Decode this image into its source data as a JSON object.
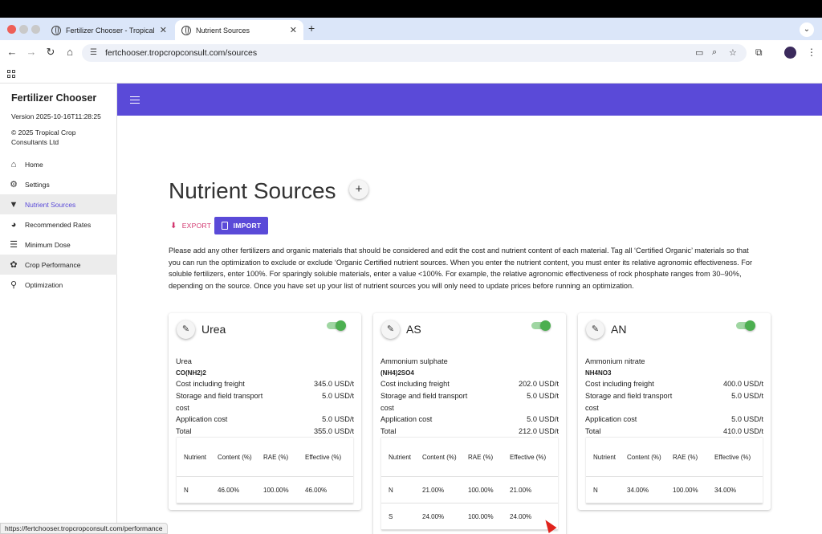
{
  "browser": {
    "tabs": [
      {
        "title": "Fertilizer Chooser - Tropical C",
        "close": "✕"
      },
      {
        "title": "Nutrient Sources",
        "close": "✕"
      }
    ],
    "new_tab": "+",
    "url": "fertchooser.tropcropconsult.com/sources",
    "status_url": "https://fertchooser.tropcropconsult.com/performance",
    "icons": [
      "back-icon",
      "forward-icon",
      "reload-icon",
      "home-icon",
      "tune-icon",
      "install-icon",
      "zoom-icon",
      "star-icon",
      "extensions-icon",
      "profile-icon",
      "menu-icon",
      "apps-icon"
    ]
  },
  "sidebar": {
    "app_title": "Fertilizer Chooser",
    "version": "Version 2025-10-16T11:28:25",
    "copyright": "© 2025 Tropical Crop Consultants Ltd",
    "items": [
      {
        "label": "Home",
        "icon": "home-icon"
      },
      {
        "label": "Settings",
        "icon": "gear-icon"
      },
      {
        "label": "Nutrient Sources",
        "icon": "filter-icon",
        "active": true
      },
      {
        "label": "Recommended Rates",
        "icon": "pie-chart-icon"
      },
      {
        "label": "Minimum Dose",
        "icon": "checklist-icon"
      },
      {
        "label": "Crop Performance",
        "icon": "crop-icon"
      },
      {
        "label": "Optimization",
        "icon": "tractor-icon"
      }
    ]
  },
  "main": {
    "title": "Nutrient Sources",
    "add_label": "+",
    "export_label": "EXPORT",
    "import_label": "IMPORT",
    "intro": "Please add any other fertilizers and organic materials that should be considered and edit the cost and nutrient content of each material. Tag all ‘Certified Organic’ materials so that you can run the optimization to exclude or exclude ‘Organic Certified nutrient sources. When you enter the nutrient content, you must enter its relative agronomic effectiveness. For soluble fertilizers, enter 100%. For sparingly soluble materials, enter a value <100%. For example, the relative agronomic effectiveness of rock phosphate ranges from 30–90%, depending on the source. Once you have set up your list of nutrient sources you will only need to update prices before running an optimization."
  },
  "table_headers": {
    "nutrient": "Nutrient",
    "content": "Content (%)",
    "rae": "RAE (%)",
    "effective": "Effective (%)"
  },
  "cost_labels": {
    "freight": "Cost including freight",
    "storage": "Storage and field transport cost",
    "application": "Application cost",
    "total": "Total"
  },
  "sources": [
    {
      "short": "Urea",
      "name": "Urea",
      "formula": "CO(NH2)2",
      "enabled": true,
      "freight": "345.0 USD/t",
      "storage": "5.0 USD/t",
      "application": "5.0 USD/t",
      "total": "355.0 USD/t",
      "nutrients": [
        {
          "nutrient": "N",
          "content": "46.00%",
          "rae": "100.00%",
          "effective": "46.00%"
        }
      ]
    },
    {
      "short": "AS",
      "name": "Ammonium sulphate",
      "formula": "(NH4)2SO4",
      "enabled": true,
      "freight": "202.0 USD/t",
      "storage": "5.0 USD/t",
      "application": "5.0 USD/t",
      "total": "212.0 USD/t",
      "nutrients": [
        {
          "nutrient": "N",
          "content": "21.00%",
          "rae": "100.00%",
          "effective": "21.00%"
        },
        {
          "nutrient": "S",
          "content": "24.00%",
          "rae": "100.00%",
          "effective": "24.00%"
        }
      ]
    },
    {
      "short": "AN",
      "name": "Ammonium nitrate",
      "formula": "NH4NO3",
      "enabled": true,
      "freight": "400.0 USD/t",
      "storage": "5.0 USD/t",
      "application": "5.0 USD/t",
      "total": "410.0 USD/t",
      "nutrients": [
        {
          "nutrient": "N",
          "content": "34.00%",
          "rae": "100.00%",
          "effective": "34.00%"
        }
      ]
    }
  ],
  "colors": {
    "primary": "#5a4ad8",
    "export": "#d2366e",
    "toggle_on": "#4caf50"
  }
}
